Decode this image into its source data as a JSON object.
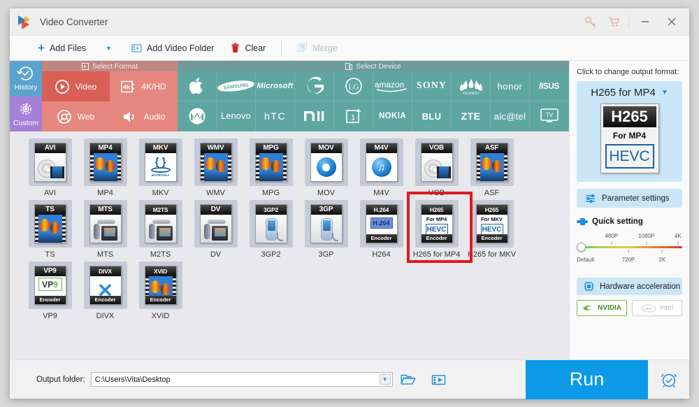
{
  "window": {
    "title": "Video Converter",
    "icons": {
      "key": "key-icon",
      "cart": "cart-icon",
      "minimize": "minimize-icon",
      "close": "close-icon"
    }
  },
  "toolbar": {
    "add_files": "Add Files",
    "add_video_folder": "Add Video Folder",
    "clear": "Clear",
    "merge": "Merge"
  },
  "sidetabs": [
    {
      "label": "History",
      "icon": "history-icon",
      "color": "#5ba3ce"
    },
    {
      "label": "Custom",
      "icon": "gear-icon",
      "color": "#a580d8"
    }
  ],
  "headers": {
    "format": "Select Format",
    "device": "Select Device"
  },
  "format_tabs": [
    {
      "label": "Video",
      "icon": "play-circle-icon",
      "selected": true
    },
    {
      "label": "4K/HD",
      "icon": "4k-icon",
      "selected": false
    },
    {
      "label": "Web",
      "icon": "chrome-icon",
      "selected": false
    },
    {
      "label": "Audio",
      "icon": "speaker-icon",
      "selected": false
    }
  ],
  "devices": [
    "Apple",
    "SAMSUNG",
    "Microsoft",
    "G",
    "LG",
    "amazon",
    "SONY",
    "HUAWEI",
    "honor",
    "ASUS",
    "Motorola",
    "Lenovo",
    "HTC",
    "MI",
    "1+",
    "NOKIA",
    "BLU",
    "ZTE",
    "alcatel",
    "TV"
  ],
  "formats": [
    {
      "label": "AVI",
      "badge": "AVI",
      "art": "disc"
    },
    {
      "label": "MP4",
      "badge": "MP4",
      "art": "balloon"
    },
    {
      "label": "MKV",
      "badge": "MKV",
      "art": "mkv"
    },
    {
      "label": "WMV",
      "badge": "WMV",
      "art": "balloon"
    },
    {
      "label": "MPG",
      "badge": "MPG",
      "art": "balloon"
    },
    {
      "label": "MOV",
      "badge": "MOV",
      "art": "quicktime"
    },
    {
      "label": "M4V",
      "badge": "M4V",
      "art": "itunes"
    },
    {
      "label": "VOB",
      "badge": "VOB",
      "art": "disc"
    },
    {
      "label": "ASF",
      "badge": "ASF",
      "art": "balloon"
    },
    {
      "label": "TS",
      "badge": "TS",
      "art": "balloon"
    },
    {
      "label": "MTS",
      "badge": "MTS",
      "art": "camcorder"
    },
    {
      "label": "M2TS",
      "badge": "M2TS",
      "art": "camcorder"
    },
    {
      "label": "DV",
      "badge": "DV",
      "art": "camcorder"
    },
    {
      "label": "3GP2",
      "badge": "3GP2",
      "art": "phone"
    },
    {
      "label": "3GP",
      "badge": "3GP",
      "art": "phone"
    },
    {
      "label": "H264",
      "badge": "H.264",
      "art": "h264",
      "sub": "H.264",
      "encoder": "Encoder"
    },
    {
      "label": "H265 for MP4",
      "badge": "H265",
      "art": "hevc",
      "sub": "For MP4",
      "hevc": "HEVC",
      "encoder": "Encoder",
      "highlighted": true
    },
    {
      "label": "H265 for MKV",
      "badge": "H265",
      "art": "hevc",
      "sub": "For MKV",
      "hevc": "HEVC",
      "encoder": "Encoder"
    },
    {
      "label": "VP9",
      "badge": "VP9",
      "art": "vp9",
      "vp9": "VP9",
      "encoder": "Encoder"
    },
    {
      "label": "DIVX",
      "badge": "DIVX",
      "art": "divx",
      "encoder": "Encoder"
    },
    {
      "label": "XVID",
      "badge": "XVID",
      "art": "balloon",
      "encoder": "Encoder"
    }
  ],
  "panel": {
    "hint": "Click to change output format:",
    "selected_format": "H265 for MP4",
    "icon": {
      "badge": "H265",
      "sub": "For MP4",
      "hevc": "HEVC"
    },
    "parameter_settings": "Parameter settings",
    "quick_setting": "Quick setting",
    "slider": {
      "top_labels": [
        "480P",
        "1080P",
        "4K"
      ],
      "bottom_labels": [
        "Default",
        "720P",
        "2K"
      ],
      "value": "Default"
    },
    "hardware_acceleration": "Hardware acceleration",
    "chips": [
      {
        "label": "NVIDIA",
        "enabled": true
      },
      {
        "label": "Intel",
        "enabled": false
      }
    ]
  },
  "bottom": {
    "output_label": "Output folder:",
    "output_path": "C:\\Users\\Vita\\Desktop",
    "run": "Run",
    "icons": {
      "browse": "open-folder-icon",
      "open_output": "video-folder-icon",
      "schedule": "alarm-clock-icon"
    }
  },
  "colors": {
    "accent": "#0c9ae8",
    "format_tab": "#e5877e",
    "format_tab_selected": "#d95f54",
    "device_bg": "#5fa6a3",
    "highlight": "#e01b1b"
  }
}
